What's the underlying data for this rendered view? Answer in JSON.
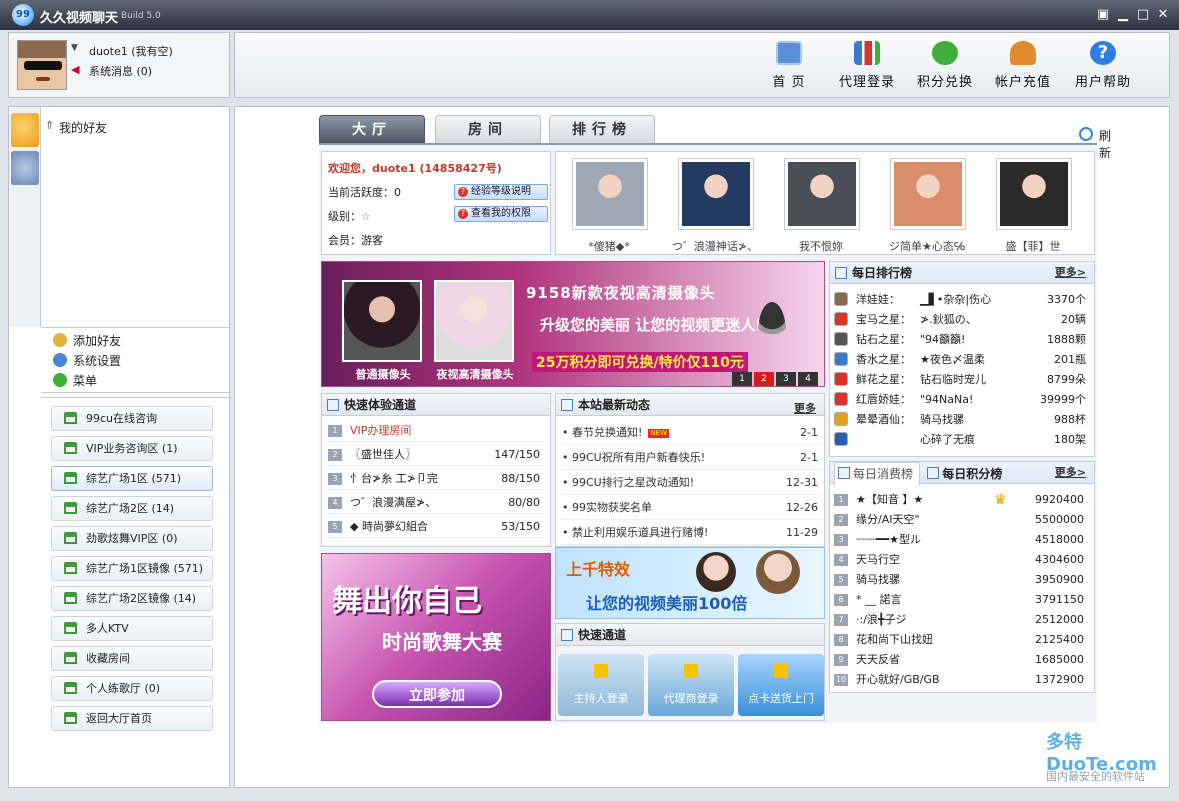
{
  "app": {
    "title": "久久视频聊天",
    "build": "Build 5.0",
    "logo_text": "99"
  },
  "user": {
    "name": "duote1 (我有空)",
    "sys_msg": "系统消息 (0)"
  },
  "topnav": [
    {
      "label": "首 页",
      "color": "#5b8fd6"
    },
    {
      "label": "代理登录",
      "color": "#3a7ad0"
    },
    {
      "label": "积分兑换",
      "color": "#3fae3a"
    },
    {
      "label": "帐户充值",
      "color": "#e08a2c"
    },
    {
      "label": "用户帮助",
      "color": "#2a7fe0"
    }
  ],
  "left": {
    "friends": "我的好友",
    "menu": [
      "添加好友",
      "系统设置",
      "菜单"
    ],
    "rooms": [
      "99cu在线咨询",
      "VIP业务咨询区 (1)",
      "综艺广场1区 (571)",
      "综艺广场2区 (14)",
      "劲歌炫舞VIP区 (0)",
      "综艺广场1区镜像 (571)",
      "综艺广场2区镜像 (14)",
      "多人KTV",
      "收藏房间",
      "个人练歌厅 (0)",
      "返回大厅首页"
    ],
    "selected_room": 2
  },
  "tabs": [
    "大厅",
    "房间",
    "排行榜"
  ],
  "refresh": "刷新",
  "welcome": {
    "title": "欢迎您，duote1 (14858427号)",
    "activity": "当前活跃度：0",
    "level": "级别：",
    "member": "会员：游客",
    "btn1": "经验等级说明",
    "btn2": "查看我的权限"
  },
  "photos": [
    {
      "name": "*傻猪◆*",
      "color": "#9fa8b5"
    },
    {
      "name": "つ゛浪漫神话≯、",
      "color": "#243a63"
    },
    {
      "name": "我不恨妳",
      "color": "#4a4f57"
    },
    {
      "name": "ジ简单★心态℅",
      "color": "#d98d6a"
    },
    {
      "name": "盛【菲】世",
      "color": "#2a2a2a"
    }
  ],
  "banner1": {
    "line1": "9158新款夜视高清摄像头",
    "line2": "升级您的美丽 让您的视频更迷人!",
    "line3": "25万积分即可兑换/特价仅110元",
    "cap1": "普通摄像头",
    "cap2": "夜视高清摄像头",
    "pages": [
      "1",
      "2",
      "3",
      "4"
    ],
    "active_page": 1
  },
  "quick": {
    "title": "快速体验通道",
    "rows": [
      {
        "name": "VIP办理房间",
        "value": "",
        "color": "#c0392b"
      },
      {
        "name": "〖盛世佳人〗",
        "value": "147/150",
        "color": "#222"
      },
      {
        "name": "忄台≯糸 工≯卩完",
        "value": "88/150",
        "color": "#222"
      },
      {
        "name": "つ゛浪漫满屋≯、",
        "value": "80/80",
        "color": "#222"
      },
      {
        "name": "◆ 時尚夢幻組合",
        "value": "53/150",
        "color": "#222"
      }
    ]
  },
  "news": {
    "title": "本站最新动态",
    "more": "更多",
    "new_badge": "NEW",
    "rows": [
      {
        "text": "春节兑换通知!",
        "date": "2-1",
        "new": true
      },
      {
        "text": "99CU祝所有用户新春快乐!",
        "date": "2-1",
        "new": false
      },
      {
        "text": "99CU排行之星改动通知!",
        "date": "12-31",
        "new": false
      },
      {
        "text": "99实物获奖名单",
        "date": "12-26",
        "new": false
      },
      {
        "text": "禁止利用娱乐道具进行赌博!",
        "date": "11-29",
        "new": false
      }
    ]
  },
  "banner2": {
    "line1": "舞出你自己",
    "line2": "时尚歌舞大赛",
    "button": "立即参加"
  },
  "banner3": {
    "line1": "上千特效",
    "line2": "让您的视频美丽100倍"
  },
  "quickch": {
    "title": "快速通道",
    "buttons": [
      {
        "label": "主持人登录",
        "color": "#8fb8d8"
      },
      {
        "label": "代理商登录",
        "color": "#6aa6d8"
      },
      {
        "label": "点卡送货上门",
        "color": "#3a8fd8"
      }
    ]
  },
  "rank": {
    "title": "每日排行榜",
    "more": "更多>",
    "rows": [
      {
        "k": "洋娃娃：",
        "name": "▁▋•杂杂|伤心",
        "v": "3370个",
        "color": "#8a6b4f"
      },
      {
        "k": "宝马之星：",
        "name": "≯.鈥狐の、",
        "v": "20辆",
        "color": "#d9342b"
      },
      {
        "k": "钻石之星：",
        "name": "\"94籲籲!",
        "v": "1888颗",
        "color": "#555"
      },
      {
        "k": "香水之星：",
        "name": "★夜色〆温柔",
        "v": "201瓶",
        "color": "#3a7ad0"
      },
      {
        "k": "鲜花之星：",
        "name": "钻石临时宠儿",
        "v": "8799朵",
        "color": "#d9342b"
      },
      {
        "k": "红唇娇娃：",
        "name": "\"94NaNa!",
        "v": "39999个",
        "color": "#d9342b"
      },
      {
        "k": "晕晕酒仙：",
        "name": "骑马找骡",
        "v": "988杯",
        "color": "#e0a020"
      },
      {
        "k": "",
        "name": "心碎了无痕",
        "v": "180架",
        "color": "#2a5fb0"
      }
    ]
  },
  "rank2": {
    "tab1": "每日消费榜",
    "tab2": "每日积分榜",
    "more": "更多>",
    "rows": [
      {
        "name": "★【知音 】★",
        "v": "9920400"
      },
      {
        "name": "缘分/AI天空\"",
        "v": "5500000"
      },
      {
        "name": "┈┈┈━━★型ル",
        "v": "4518000"
      },
      {
        "name": "天马行空",
        "v": "4304600"
      },
      {
        "name": "骑马找骡",
        "v": "3950900"
      },
      {
        "name": "*  __ 諾言",
        "v": "3791150"
      },
      {
        "name": "·:/浪╋子ジ",
        "v": "2512000"
      },
      {
        "name": "花和尚下山找妞",
        "v": "2125400"
      },
      {
        "name": "天天反省",
        "v": "1685000"
      },
      {
        "name": "开心就好/GB/GB",
        "v": "1372900"
      }
    ]
  },
  "watermark": {
    "brand": "多特 DuoTe.com",
    "slogan": "国内最安全的软件站"
  }
}
